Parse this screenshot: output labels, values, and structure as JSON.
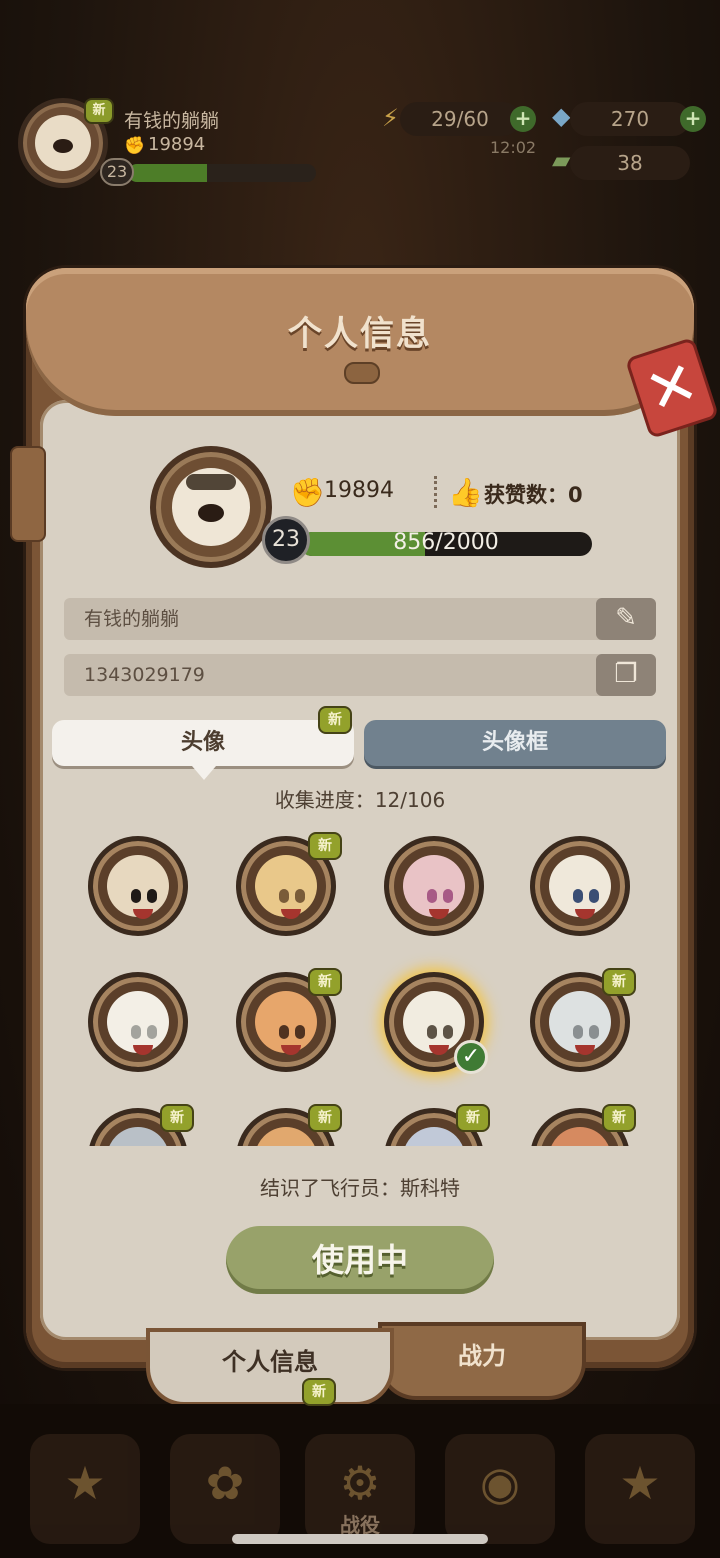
{
  "hud": {
    "player_name": "有钱的躺躺",
    "coins": "19894",
    "level": "23",
    "energy": "29/60",
    "energy_timer": "12:02",
    "gems": "270",
    "tickets": "38",
    "new_badge": "新",
    "plus": "+"
  },
  "panel": {
    "title": "个人信息",
    "close_glyph": "✕"
  },
  "profile": {
    "coins": "19894",
    "likes_label": "获赞数：",
    "likes_value": "0",
    "level": "23",
    "xp": "856/2000",
    "xp_fraction": 0.428,
    "name": "有钱的躺躺",
    "id": "1343029179"
  },
  "tabs": {
    "avatar": "头像",
    "frame": "头像框",
    "new_badge": "新"
  },
  "collection": {
    "label": "收集进度：",
    "progress": "12/106"
  },
  "avatars": [
    {
      "colors": [
        "#e7d8bf",
        "#1f1a17"
      ],
      "new": false,
      "selected": false
    },
    {
      "colors": [
        "#e9c88a",
        "#7a5c39"
      ],
      "new": true,
      "selected": false
    },
    {
      "colors": [
        "#e9c3c6",
        "#a85a86"
      ],
      "new": false,
      "selected": false
    },
    {
      "colors": [
        "#efe8da",
        "#3a4e74"
      ],
      "new": false,
      "selected": false
    },
    {
      "colors": [
        "#f3efe6",
        "#a3a39d"
      ],
      "new": false,
      "selected": false
    },
    {
      "colors": [
        "#e7a66b",
        "#4f3220"
      ],
      "new": true,
      "selected": false
    },
    {
      "colors": [
        "#f1ece0",
        "#5d5346"
      ],
      "new": false,
      "selected": true
    },
    {
      "colors": [
        "#dde1e1",
        "#8a8f91"
      ],
      "new": true,
      "selected": false
    },
    {
      "colors": [
        "#b9c0c7",
        "#6c7379"
      ],
      "new": true,
      "selected": false
    },
    {
      "colors": [
        "#e1a86e",
        "#8a5a32"
      ],
      "new": true,
      "selected": false
    },
    {
      "colors": [
        "#c1c9d8",
        "#3e5988"
      ],
      "new": true,
      "selected": false
    },
    {
      "colors": [
        "#d68a60",
        "#7a2f22"
      ],
      "new": true,
      "selected": false
    }
  ],
  "status_text": "结识了飞行员：斯科特",
  "use_button": "使用中",
  "bottom_tabs": {
    "info": "个人信息",
    "power": "战力"
  },
  "bottom_nav": {
    "campaign": "战役"
  }
}
